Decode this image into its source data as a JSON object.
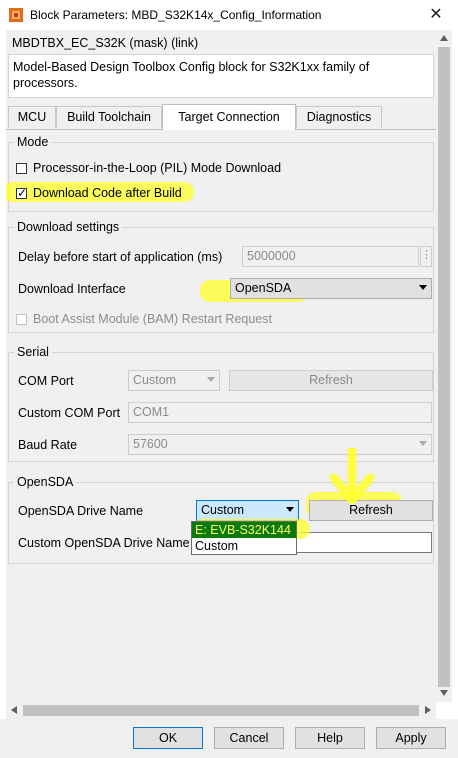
{
  "window": {
    "title": "Block Parameters: MBD_S32K14x_Config_Information",
    "close_glyph": "✕"
  },
  "header": {
    "block_type": "MBDTBX_EC_S32K (mask) (link)",
    "description": "Model-Based Design Toolbox Config block for S32K1xx family of processors."
  },
  "tabs": [
    {
      "label": "MCU"
    },
    {
      "label": "Build Toolchain"
    },
    {
      "label": "Target Connection",
      "active": true
    },
    {
      "label": "Diagnostics"
    }
  ],
  "mode": {
    "title": "Mode",
    "pil_label": "Processor-in-the-Loop (PIL) Mode Download",
    "pil_checked": false,
    "download_label": "Download Code after Build",
    "download_checked": true
  },
  "download_settings": {
    "title": "Download settings",
    "delay_label": "Delay before start of application (ms)",
    "delay_value": "5000000",
    "interface_label": "Download Interface",
    "interface_value": "OpenSDA",
    "bam_label": "Boot Assist Module (BAM) Restart Request",
    "bam_checked": false
  },
  "serial": {
    "title": "Serial",
    "com_port_label": "COM Port",
    "com_port_value": "Custom",
    "refresh_label": "Refresh",
    "custom_com_label": "Custom COM Port",
    "custom_com_value": "COM1",
    "baud_label": "Baud Rate",
    "baud_value": "57600"
  },
  "opensda": {
    "title": "OpenSDA",
    "drive_label": "OpenSDA Drive Name",
    "drive_value": "Custom",
    "refresh_label": "Refresh",
    "custom_drive_label": "Custom OpenSDA Drive Name",
    "custom_drive_value": "",
    "dropdown_options": [
      "E: EVB-S32K144",
      "Custom"
    ],
    "dropdown_highlighted": "E: EVB-S32K144"
  },
  "buttons": {
    "ok": "OK",
    "cancel": "Cancel",
    "help": "Help",
    "apply": "Apply"
  },
  "colors": {
    "highlighter": "#ffff2a",
    "dropdown_selection": "#0a7a0a",
    "default_button_border": "#0078d7"
  }
}
